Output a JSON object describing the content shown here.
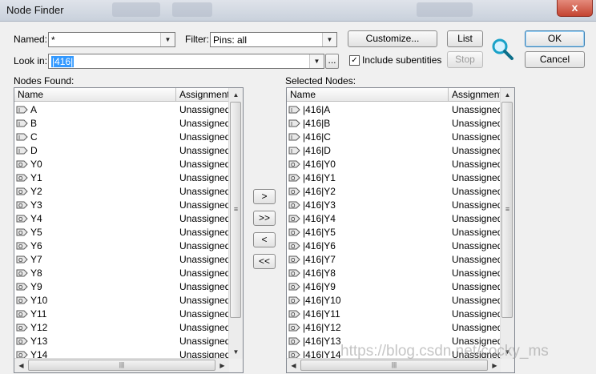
{
  "window": {
    "title": "Node Finder",
    "close_glyph": "x"
  },
  "named": {
    "label": "Named:",
    "value": "*"
  },
  "filter": {
    "label": "Filter:",
    "value": "Pins: all"
  },
  "look_in": {
    "label": "Look in:",
    "value": "|416|",
    "browse_label": "..."
  },
  "include_subentities": {
    "label": "Include subentities",
    "checked": true
  },
  "buttons": {
    "customize": "Customize...",
    "list": "List",
    "stop": "Stop",
    "ok": "OK",
    "cancel": "Cancel",
    "add": ">",
    "add_all": ">>",
    "remove": "<",
    "remove_all": "<<"
  },
  "nodes_found": {
    "title": "Nodes Found:",
    "columns": [
      "Name",
      "Assignments"
    ],
    "rows": [
      {
        "name": "A",
        "assignment": "Unassigned",
        "kind": "input"
      },
      {
        "name": "B",
        "assignment": "Unassigned",
        "kind": "input"
      },
      {
        "name": "C",
        "assignment": "Unassigned",
        "kind": "input"
      },
      {
        "name": "D",
        "assignment": "Unassigned",
        "kind": "input"
      },
      {
        "name": "Y0",
        "assignment": "Unassigned",
        "kind": "output"
      },
      {
        "name": "Y1",
        "assignment": "Unassigned",
        "kind": "output"
      },
      {
        "name": "Y2",
        "assignment": "Unassigned",
        "kind": "output"
      },
      {
        "name": "Y3",
        "assignment": "Unassigned",
        "kind": "output"
      },
      {
        "name": "Y4",
        "assignment": "Unassigned",
        "kind": "output"
      },
      {
        "name": "Y5",
        "assignment": "Unassigned",
        "kind": "output"
      },
      {
        "name": "Y6",
        "assignment": "Unassigned",
        "kind": "output"
      },
      {
        "name": "Y7",
        "assignment": "Unassigned",
        "kind": "output"
      },
      {
        "name": "Y8",
        "assignment": "Unassigned",
        "kind": "output"
      },
      {
        "name": "Y9",
        "assignment": "Unassigned",
        "kind": "output"
      },
      {
        "name": "Y10",
        "assignment": "Unassigned",
        "kind": "output"
      },
      {
        "name": "Y11",
        "assignment": "Unassigned",
        "kind": "output"
      },
      {
        "name": "Y12",
        "assignment": "Unassigned",
        "kind": "output"
      },
      {
        "name": "Y13",
        "assignment": "Unassigned",
        "kind": "output"
      },
      {
        "name": "Y14",
        "assignment": "Unassigned",
        "kind": "output"
      }
    ]
  },
  "selected_nodes": {
    "title": "Selected Nodes:",
    "columns": [
      "Name",
      "Assignments"
    ],
    "rows": [
      {
        "name": "|416|A",
        "assignment": "Unassigned",
        "kind": "input"
      },
      {
        "name": "|416|B",
        "assignment": "Unassigned",
        "kind": "input"
      },
      {
        "name": "|416|C",
        "assignment": "Unassigned",
        "kind": "input"
      },
      {
        "name": "|416|D",
        "assignment": "Unassigned",
        "kind": "input"
      },
      {
        "name": "|416|Y0",
        "assignment": "Unassigned",
        "kind": "output"
      },
      {
        "name": "|416|Y1",
        "assignment": "Unassigned",
        "kind": "output"
      },
      {
        "name": "|416|Y2",
        "assignment": "Unassigned",
        "kind": "output"
      },
      {
        "name": "|416|Y3",
        "assignment": "Unassigned",
        "kind": "output"
      },
      {
        "name": "|416|Y4",
        "assignment": "Unassigned",
        "kind": "output"
      },
      {
        "name": "|416|Y5",
        "assignment": "Unassigned",
        "kind": "output"
      },
      {
        "name": "|416|Y6",
        "assignment": "Unassigned",
        "kind": "output"
      },
      {
        "name": "|416|Y7",
        "assignment": "Unassigned",
        "kind": "output"
      },
      {
        "name": "|416|Y8",
        "assignment": "Unassigned",
        "kind": "output"
      },
      {
        "name": "|416|Y9",
        "assignment": "Unassigned",
        "kind": "output"
      },
      {
        "name": "|416|Y10",
        "assignment": "Unassigned",
        "kind": "output"
      },
      {
        "name": "|416|Y11",
        "assignment": "Unassigned",
        "kind": "output"
      },
      {
        "name": "|416|Y12",
        "assignment": "Unassigned",
        "kind": "output"
      },
      {
        "name": "|416|Y13",
        "assignment": "Unassigned",
        "kind": "output"
      },
      {
        "name": "|416|Y14",
        "assignment": "Unassigned",
        "kind": "output"
      }
    ]
  },
  "icons": {
    "input_pin": "input-pin-icon",
    "output_pin": "output-pin-icon",
    "search": "magnifier-icon",
    "close": "close-icon"
  },
  "colors": {
    "selection": "#3399ff",
    "close_button": "#c44431",
    "magnifier": "#1aa2c8"
  },
  "watermark": "https://blog.csdn.net/cocky_ms"
}
